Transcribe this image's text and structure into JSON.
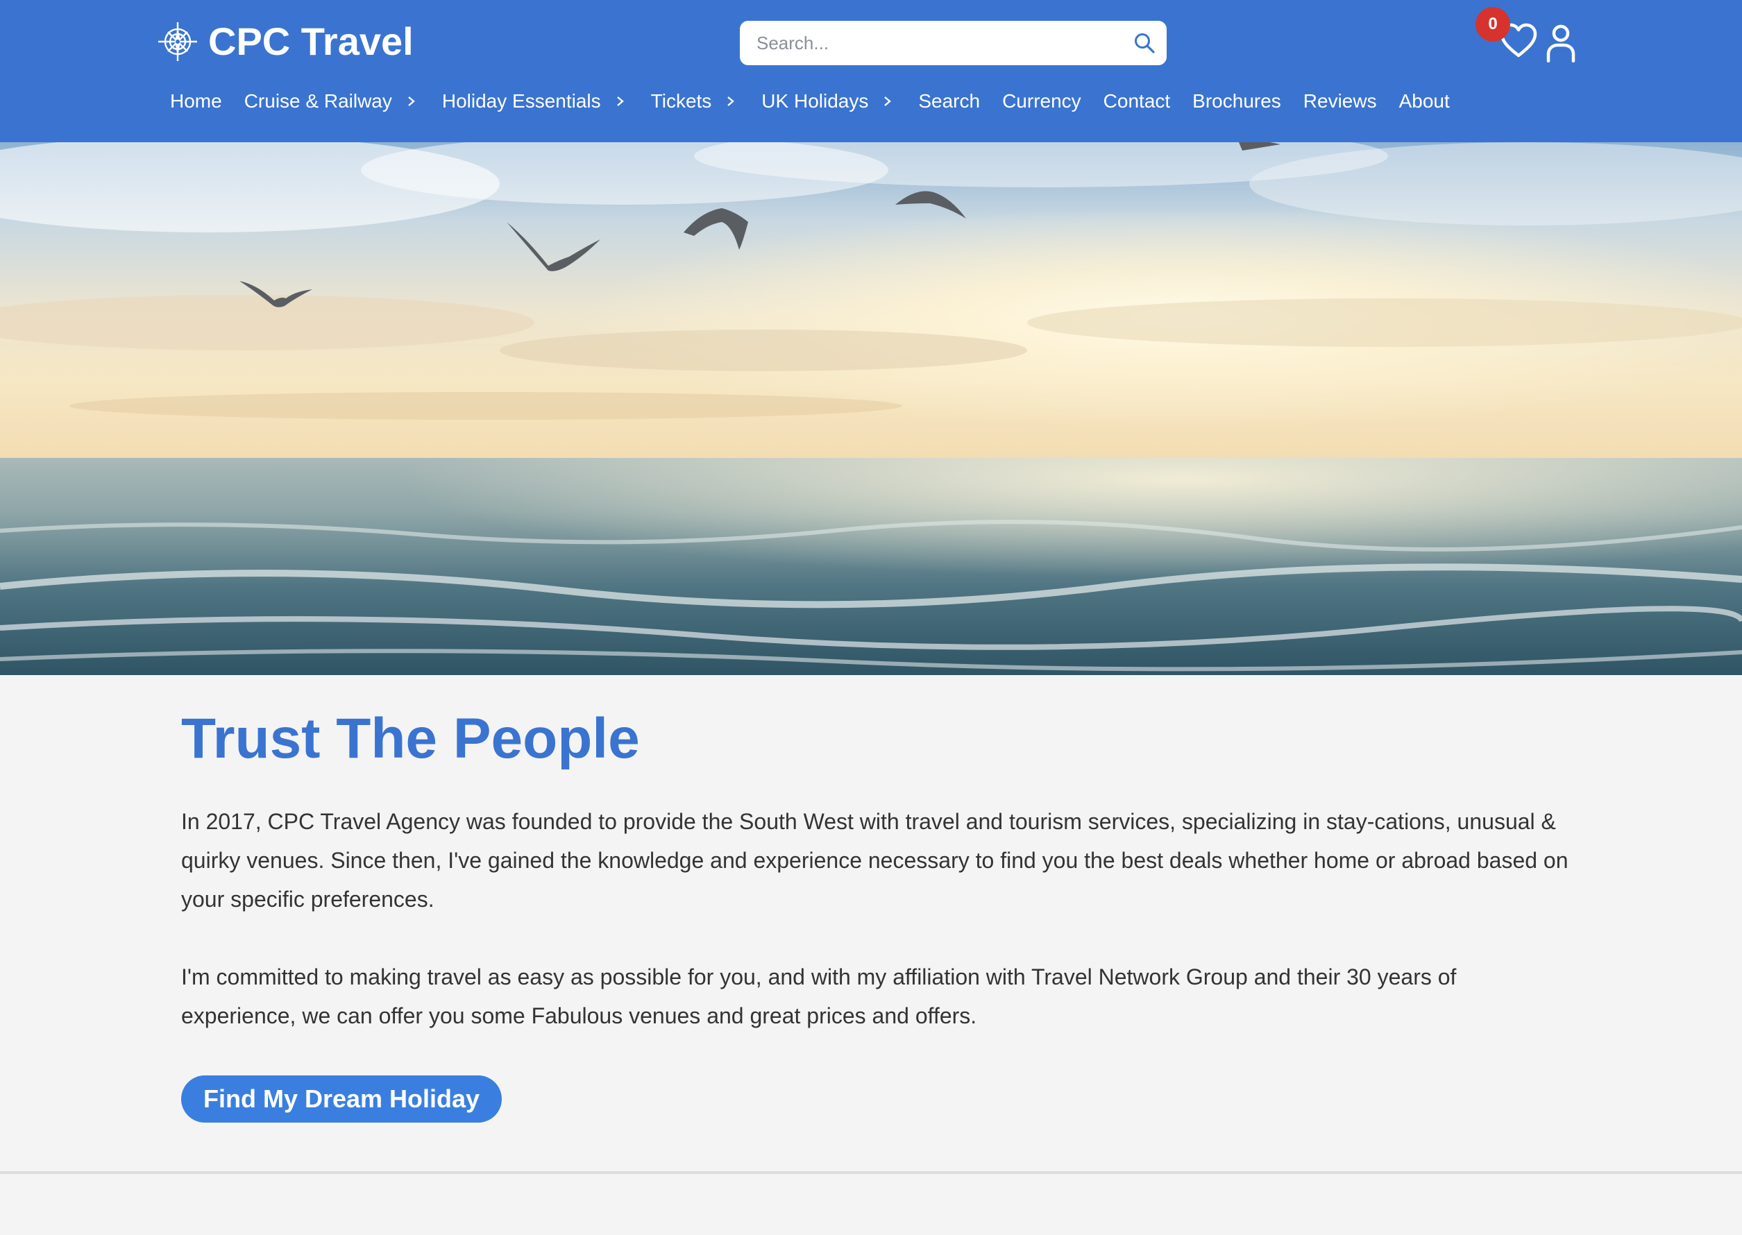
{
  "header": {
    "logo_text": "CPC Travel",
    "logo_icon": "compass-icon",
    "search": {
      "placeholder": "Search..."
    },
    "wishlist_count": "0",
    "nav": [
      {
        "label": "Home",
        "has_dropdown": false
      },
      {
        "label": "Cruise & Railway",
        "has_dropdown": true
      },
      {
        "label": "Holiday Essentials",
        "has_dropdown": true
      },
      {
        "label": "Tickets",
        "has_dropdown": true
      },
      {
        "label": "UK Holidays",
        "has_dropdown": true
      },
      {
        "label": "Search",
        "has_dropdown": false
      },
      {
        "label": "Currency",
        "has_dropdown": false
      },
      {
        "label": "Contact",
        "has_dropdown": false
      },
      {
        "label": "Brochures",
        "has_dropdown": false
      },
      {
        "label": "Reviews",
        "has_dropdown": false
      },
      {
        "label": "About",
        "has_dropdown": false
      }
    ]
  },
  "hero": {
    "icon": "seascape-with-seagulls-image"
  },
  "main": {
    "headline": "Trust The People",
    "paragraphs": [
      "In 2017, CPC Travel Agency was founded to provide the South West with travel and tourism services, specializing in stay-cations, unusual & quirky venues. Since then, I've gained the knowledge and experience necessary to find you the best deals whether home or abroad based on your specific preferences.",
      "I'm committed to making travel as easy as possible for you, and with my affiliation with Travel Network Group and their 30 years of experience, we can offer you some Fabulous venues and great prices and offers."
    ],
    "cta_label": "Find My Dream Holiday"
  },
  "colors": {
    "header_bg": "#3a74d0",
    "headline": "#3a74d0",
    "cta_bg": "#3a7fe0",
    "badge_bg": "#d6332f",
    "page_bg": "#f4f4f4"
  }
}
